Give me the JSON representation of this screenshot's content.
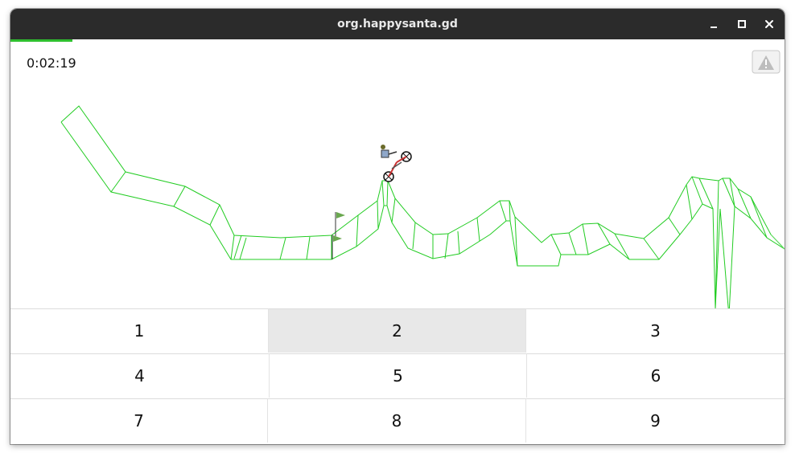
{
  "window": {
    "title": "org.happysanta.gd"
  },
  "game": {
    "timer": "0:02:19",
    "level_progress": 0.08,
    "colors": {
      "track": "#22cc22",
      "track_faint": "#66dd66",
      "flag": "#6aa84f",
      "progress": "#2fbf2f"
    },
    "icons": {
      "warning": "warning-triangle-icon",
      "finish_flag": "flag-icon",
      "rider": "motorbike-rider-icon"
    }
  },
  "keypad": {
    "keys": [
      "1",
      "2",
      "3",
      "4",
      "5",
      "6",
      "7",
      "8",
      "9"
    ],
    "pressed_key": "2"
  }
}
